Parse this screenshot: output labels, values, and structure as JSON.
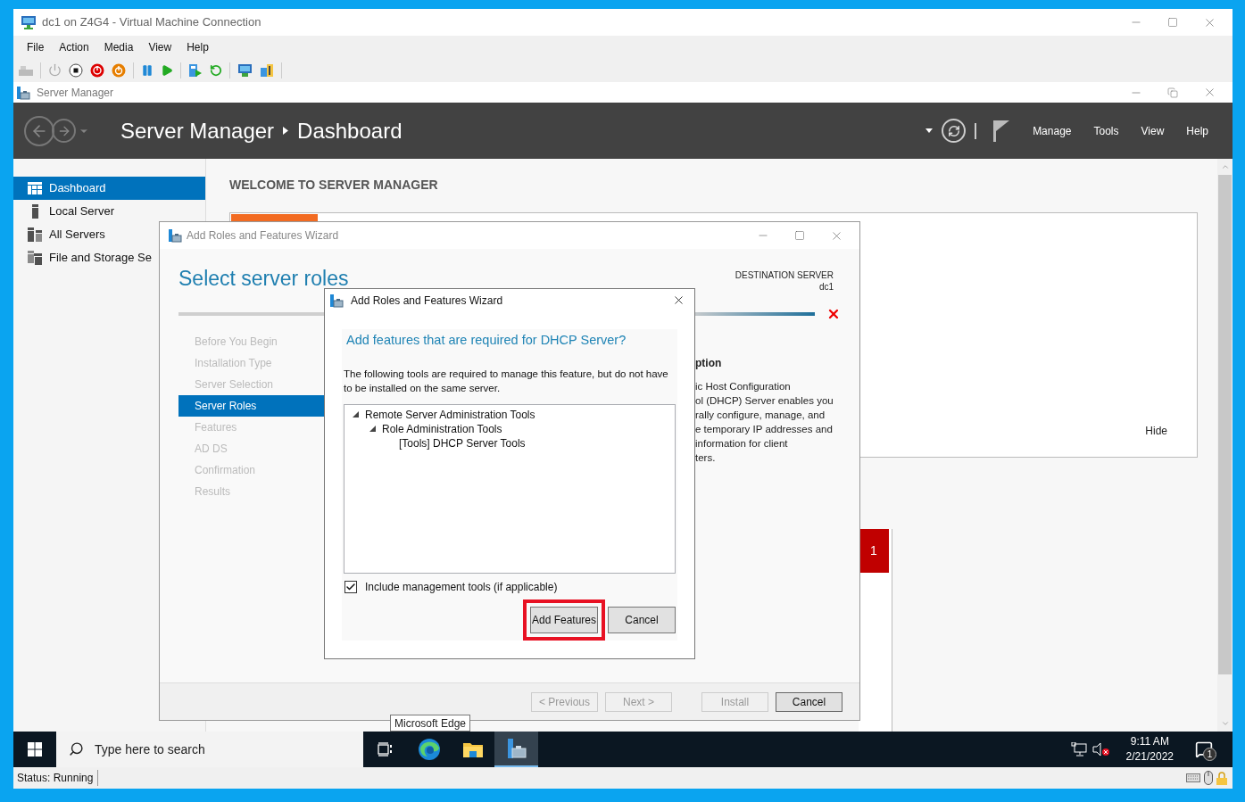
{
  "vm_window": {
    "title": "dc1 on Z4G4 - Virtual Machine Connection",
    "menu": [
      "File",
      "Action",
      "Media",
      "View",
      "Help"
    ],
    "status": "Status: Running"
  },
  "server_manager": {
    "title": "Server Manager",
    "breadcrumb": [
      "Server Manager",
      "Dashboard"
    ],
    "header_menu": [
      "Manage",
      "Tools",
      "View",
      "Help"
    ],
    "sidebar": [
      {
        "label": "Dashboard",
        "selected": true,
        "kind": "dashboard"
      },
      {
        "label": "Local Server",
        "selected": false,
        "kind": "local"
      },
      {
        "label": "All Servers",
        "selected": false,
        "kind": "all"
      },
      {
        "label": "File and Storage Se",
        "selected": false,
        "kind": "storage"
      }
    ],
    "welcome": "WELCOME TO SERVER MANAGER",
    "hide": "Hide",
    "badge": "1"
  },
  "wizard": {
    "title": "Add Roles and Features Wizard",
    "heading": "Select server roles",
    "destination_label": "DESTINATION SERVER",
    "destination_value": "dc1",
    "steps": [
      {
        "label": "Before You Begin",
        "selected": false
      },
      {
        "label": "Installation Type",
        "selected": false
      },
      {
        "label": "Server Selection",
        "selected": false
      },
      {
        "label": "Server Roles",
        "selected": true
      },
      {
        "label": "Features",
        "selected": false
      },
      {
        "label": "AD DS",
        "selected": false
      },
      {
        "label": "Confirmation",
        "selected": false
      },
      {
        "label": "Results",
        "selected": false
      }
    ],
    "description_title": "ption",
    "description_lines": [
      "ic Host Configuration",
      "ol (DHCP) Server enables you",
      "rally configure, manage, and",
      "e temporary IP addresses and",
      "information for client",
      "ters."
    ],
    "buttons": [
      {
        "label": "< Previous",
        "disabled": true
      },
      {
        "label": "Next >",
        "disabled": true
      },
      {
        "label": "Install",
        "disabled": true
      },
      {
        "label": "Cancel",
        "disabled": false
      }
    ]
  },
  "dialog": {
    "title": "Add Roles and Features Wizard",
    "heading": "Add features that are required for DHCP Server?",
    "description": "The following tools are required to manage this feature, but do not have to be installed on the same server.",
    "tree": [
      {
        "label": "Remote Server Administration Tools",
        "expanded": true,
        "children": [
          {
            "label": "Role Administration Tools",
            "expanded": true,
            "children": [
              {
                "label": "[Tools] DHCP Server Tools"
              }
            ]
          }
        ]
      }
    ],
    "include_tools": {
      "label": "Include management tools (if applicable)",
      "checked": true
    },
    "buttons": [
      {
        "label": "Add Features",
        "highlighted": true
      },
      {
        "label": "Cancel",
        "highlighted": false
      }
    ]
  },
  "taskbar": {
    "search_placeholder": "Type here to search",
    "apps": [
      {
        "kind": "task_view",
        "selected": false
      },
      {
        "kind": "edge",
        "selected": false
      },
      {
        "kind": "explorer",
        "selected": false
      },
      {
        "kind": "server_manager",
        "selected": true
      }
    ],
    "tooltip": "Microsoft Edge",
    "time": "9:11 AM",
    "date": "2/21/2022",
    "notification_count": "1"
  }
}
